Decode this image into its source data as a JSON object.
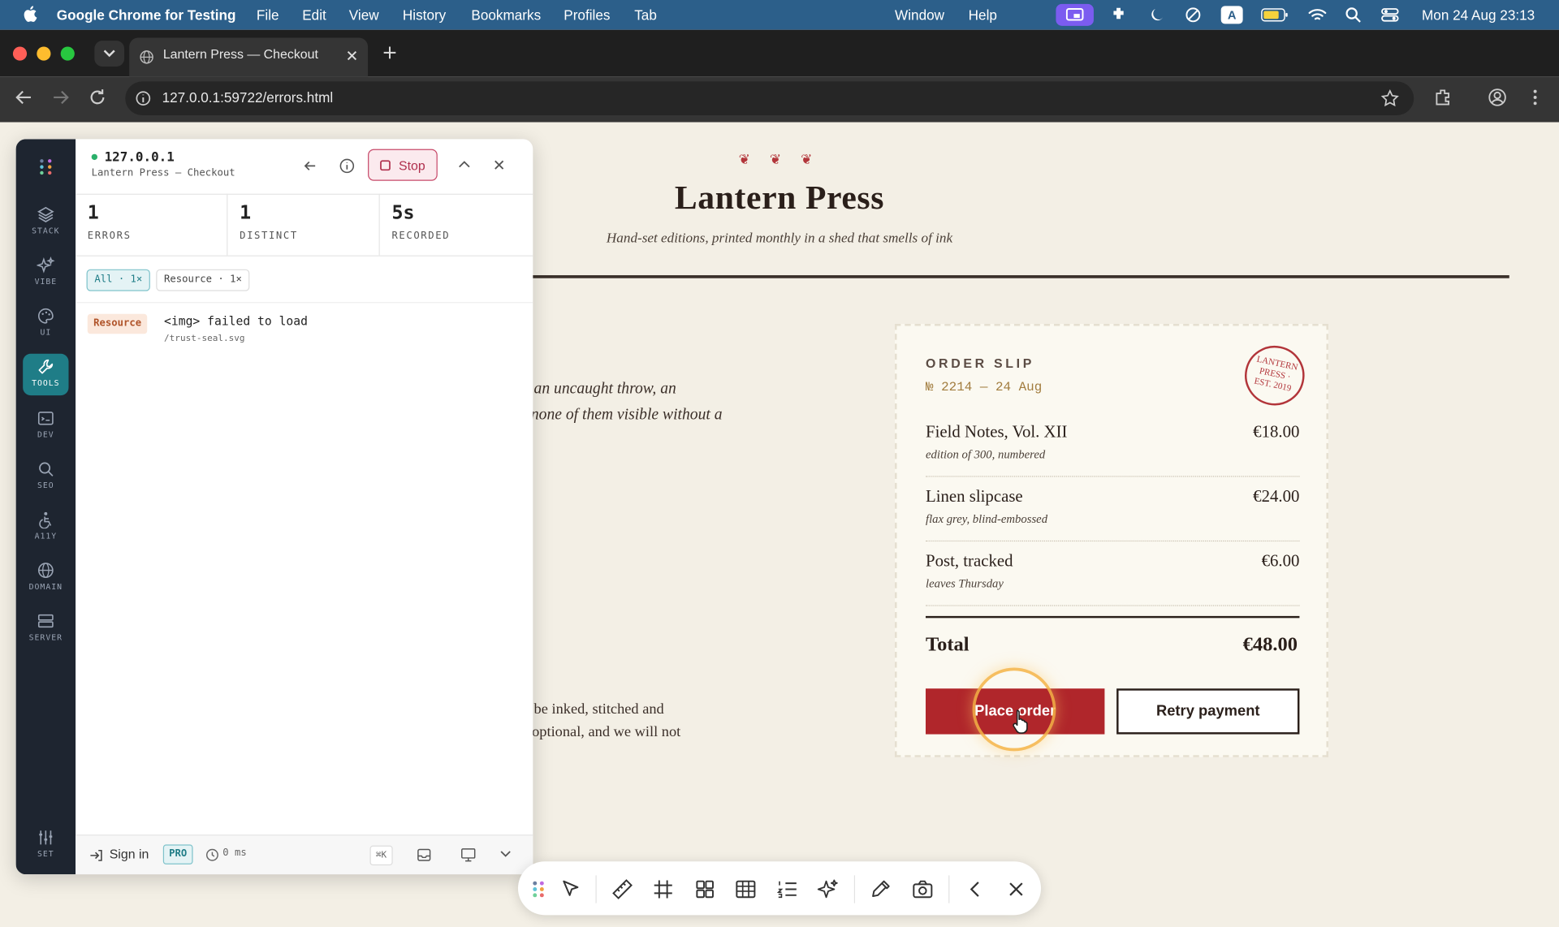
{
  "menubar": {
    "app_name": "Google Chrome for Testing",
    "menus": [
      "File",
      "Edit",
      "View",
      "History",
      "Bookmarks",
      "Profiles",
      "Tab",
      "Window",
      "Help"
    ],
    "clock": "Mon 24 Aug  23:13",
    "input_badge": "A"
  },
  "browser": {
    "tab_title": "Lantern Press — Checkout",
    "url": "127.0.0.1:59722/errors.html"
  },
  "site": {
    "ornament": "❦ ❦ ❦",
    "title": "Lantern Press",
    "tagline": "Hand-set editions, printed monthly in a shed that smells of ink",
    "bg_italic_1": "an uncaught throw, an",
    "bg_italic_2": "none of them visible without a",
    "bg_body_1": "be inked, stitched and",
    "bg_body_2": "optional, and we will not"
  },
  "order": {
    "label": "ORDER SLIP",
    "number": "№ 2214 — 24 Aug",
    "stamp_text": "LANTERN · PRESS · EST. 2019",
    "items": [
      {
        "name": "Field Notes, Vol. XII",
        "sub": "edition of 300, numbered",
        "price": "€18.00"
      },
      {
        "name": "Linen slipcase",
        "sub": "flax grey, blind-embossed",
        "price": "€24.00"
      },
      {
        "name": "Post, tracked",
        "sub": "leaves Thursday",
        "price": "€6.00"
      }
    ],
    "total_label": "Total",
    "total_value": "€48.00",
    "place_order": "Place order",
    "retry_payment": "Retry payment"
  },
  "panel": {
    "host": "127.0.0.1",
    "page": "Lantern Press — Checkout",
    "stop_label": "Stop",
    "stats": [
      {
        "value": "1",
        "label": "ERRORS"
      },
      {
        "value": "1",
        "label": "DISTINCT"
      },
      {
        "value": "5s",
        "label": "RECORDED"
      }
    ],
    "filters": [
      "All · 1×",
      "Resource · 1×"
    ],
    "errors": [
      {
        "type": "Resource",
        "message": "<img> failed to load",
        "source": "/trust-seal.svg"
      }
    ],
    "sidebar": [
      "STACK",
      "VIBE",
      "UI",
      "TOOLS",
      "DEV",
      "SEO",
      "A11Y",
      "DOMAIN",
      "SERVER",
      "SET"
    ],
    "footer": {
      "sign_in": "Sign in",
      "pro": "PRO",
      "timer": "0 ms",
      "shortcut": "⌘K"
    }
  },
  "colors": {
    "accent_red": "#b0262b",
    "teal_active": "#1f7d87",
    "page_bg": "#f3efe5",
    "menubar_blue": "#2c5f8a"
  }
}
